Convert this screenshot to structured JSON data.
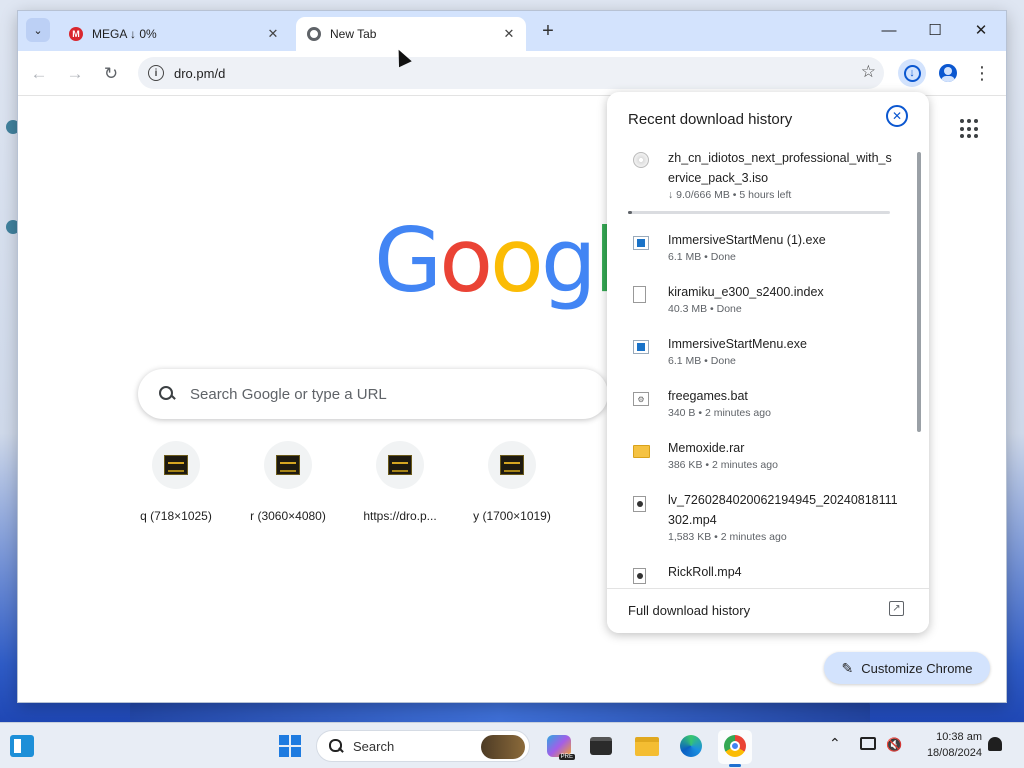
{
  "browser": {
    "tabs": [
      {
        "label": "MEGA ↓ 0%",
        "icon": "mega-icon",
        "active": false
      },
      {
        "label": "New Tab",
        "icon": "chrome-icon",
        "active": true
      }
    ],
    "tab_close_glyph": "✕",
    "new_tab_glyph": "+",
    "tab_search_glyph": "⌄",
    "window_controls": {
      "minimize": "—",
      "maximize": "☐",
      "close": "✕"
    },
    "nav": {
      "back": "←",
      "forward": "→",
      "reload": "↻"
    },
    "address": "dro.pm/d",
    "bookmark_glyph": "☆",
    "menu_glyph": "⋮"
  },
  "newtab": {
    "logo_letters": [
      {
        "ch": "G",
        "color": "#4285F4"
      },
      {
        "ch": "o",
        "color": "#EA4335"
      },
      {
        "ch": "o",
        "color": "#FBBC05"
      },
      {
        "ch": "g",
        "color": "#4285F4"
      },
      {
        "ch": "l",
        "color": "#34A853"
      }
    ],
    "search_placeholder": "Search Google or type a URL",
    "shortcuts": [
      {
        "label": "q (718×1025)"
      },
      {
        "label": "r (3060×4080)"
      },
      {
        "label": "https://dro.p..."
      },
      {
        "label": "y (1700×1019)"
      }
    ],
    "customize_label": "Customize Chrome",
    "customize_icon": "pencil-icon"
  },
  "downloads": {
    "title": "Recent download history",
    "close_glyph": "✕",
    "items": [
      {
        "name": "zh_cn_idiotos_next_professional_with_service_pack_3.iso",
        "status": "↓ 9.0/666 MB • 5 hours left",
        "icon": "disc-icon",
        "progress": 0.0135
      },
      {
        "name": "ImmersiveStartMenu (1).exe",
        "status": "6.1 MB • Done",
        "icon": "exe-icon"
      },
      {
        "name": "kiramiku_e300_s2400.index",
        "status": "40.3 MB • Done",
        "icon": "document-icon"
      },
      {
        "name": "ImmersiveStartMenu.exe",
        "status": "6.1 MB • Done",
        "icon": "exe-icon"
      },
      {
        "name": "freegames.bat",
        "status": "340 B • 2 minutes ago",
        "icon": "batch-file-icon"
      },
      {
        "name": "Memoxide.rar",
        "status": "386 KB • 2 minutes ago",
        "icon": "folder-icon"
      },
      {
        "name": "lv_7260284020062194945_20240818111302.mp4",
        "status": "1,583 KB • 2 minutes ago",
        "icon": "video-file-icon"
      },
      {
        "name": "RickRoll.mp4",
        "status": "",
        "icon": "video-file-icon"
      }
    ],
    "footer_label": "Full download history",
    "footer_icon_glyph": "↗"
  },
  "taskbar": {
    "search_label": "Search",
    "copilot_badge": "PRE",
    "tray_chevron": "⌃",
    "tray_volume_glyph": "🔇",
    "time": "10:38 am",
    "date": "18/08/2024"
  }
}
